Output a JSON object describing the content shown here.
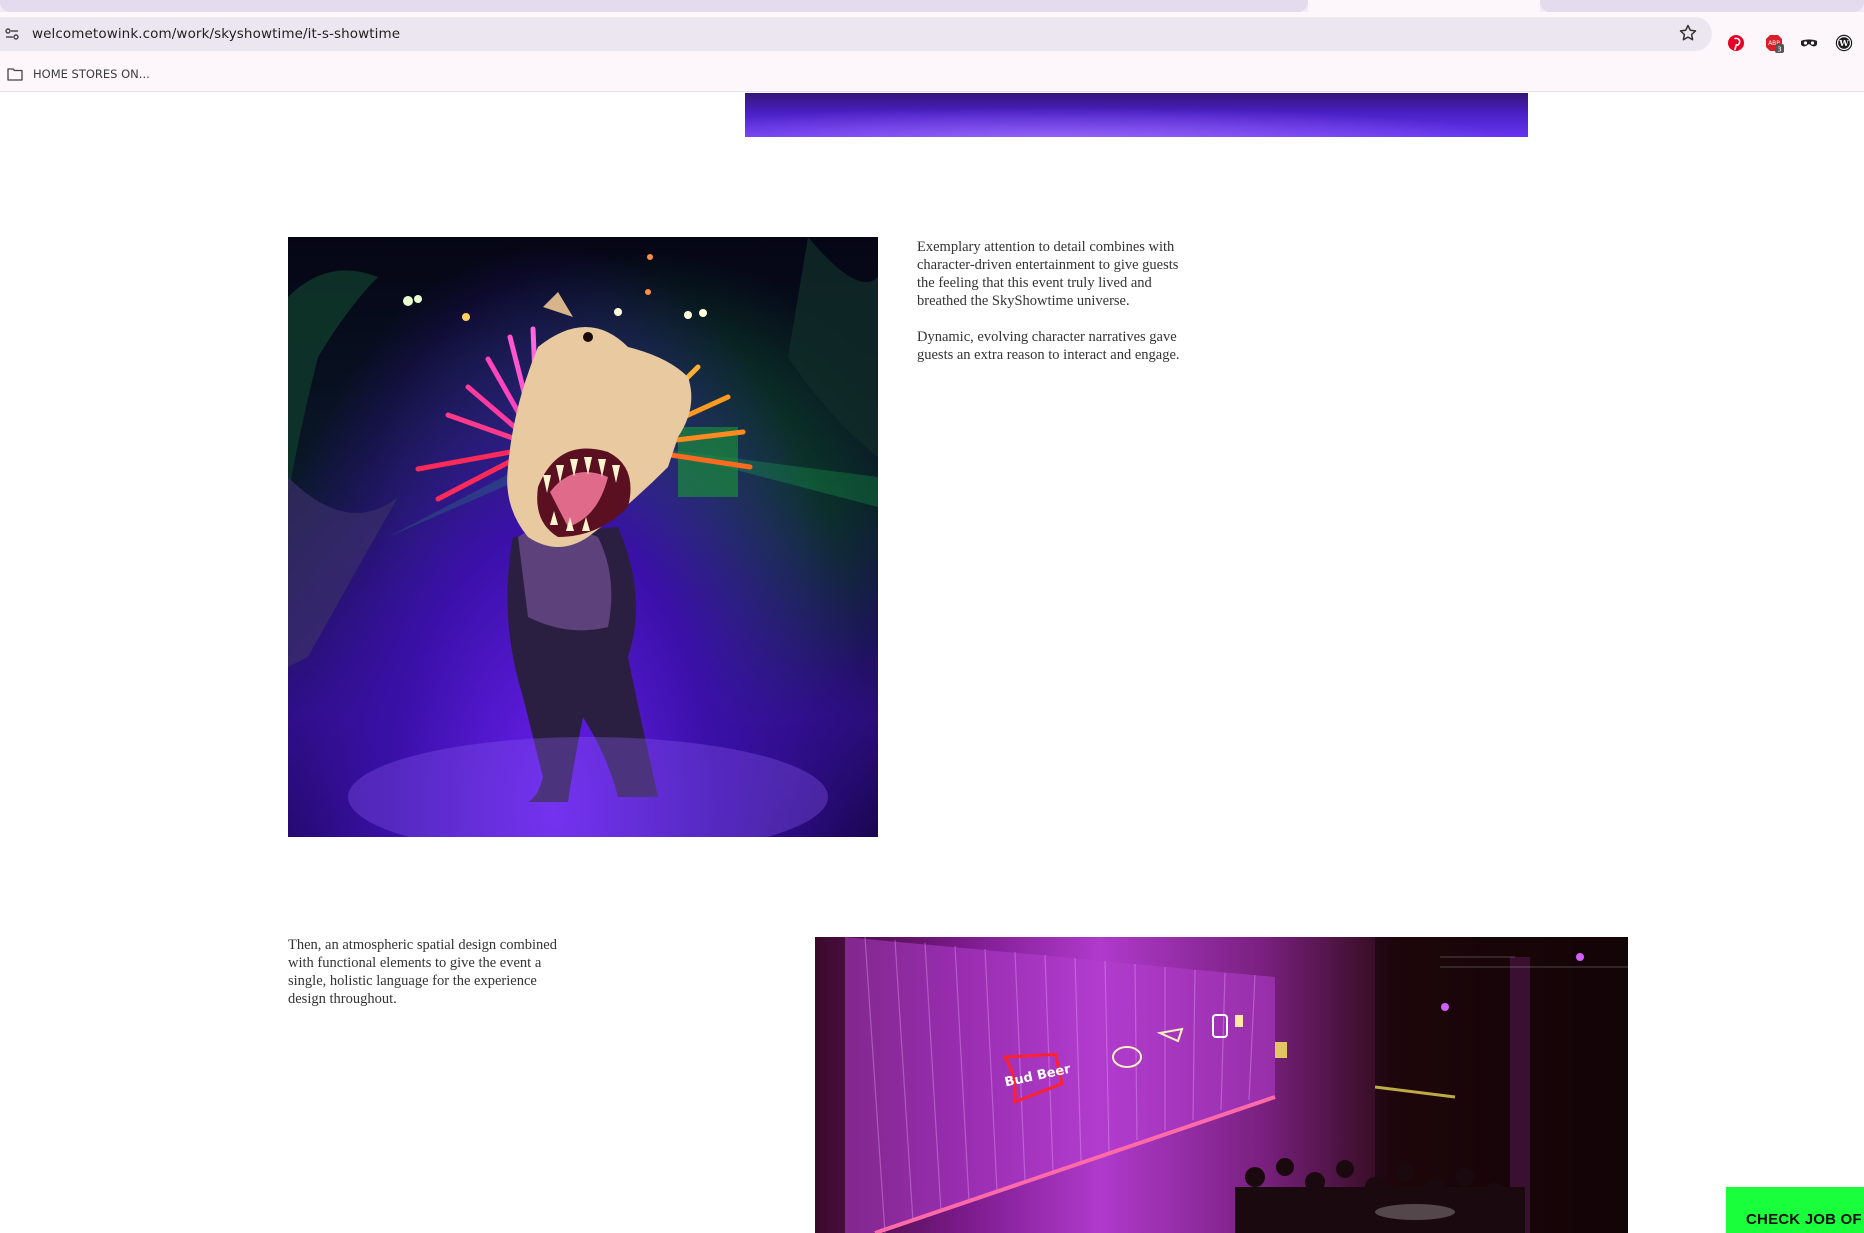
{
  "browser": {
    "url": "welcometowink.com/work/skyshowtime/it-s-showtime",
    "bookmark_label": "HOME STORES ON...",
    "icons": {
      "site_info": "tune-icon",
      "bookmark_star": "star-icon",
      "bookmark_folder": "folder-icon",
      "extensions": [
        "pinterest-icon",
        "adblock-icon",
        "mask-icon",
        "wordpress-icon"
      ]
    },
    "extension_badge": "3"
  },
  "content": {
    "right_column": [
      "Exemplary attention to detail combines with character-driven entertainment to give guests the feeling that this event truly lived and breathed the SkyShowtime universe.",
      "Dynamic, evolving character narratives gave guests an extra reason to interact and engage."
    ],
    "left_column": [
      "Then, an atmospheric spatial design combined with functional elements to give the event a single, holistic language for the experience design throughout."
    ],
    "neon_sign": "Bud Beer",
    "cta_label": "CHECK JOB OF"
  },
  "colors": {
    "accent_cta": "#19ff3c",
    "chrome_bg": "#fdf6fb",
    "omnibox_bg": "#ece6f0",
    "body_text": "#333333"
  }
}
